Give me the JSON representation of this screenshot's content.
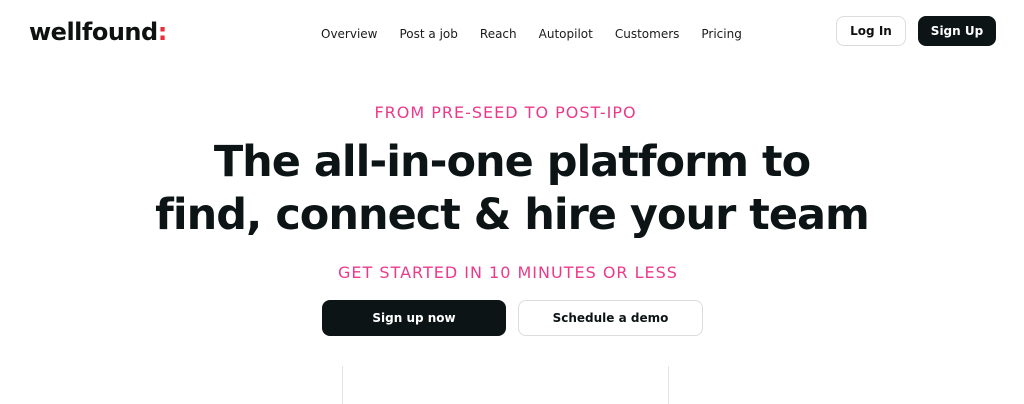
{
  "header": {
    "logo_text": "wellfound",
    "logo_colon": ":",
    "nav": [
      {
        "label": "Overview"
      },
      {
        "label": "Post a job"
      },
      {
        "label": "Reach"
      },
      {
        "label": "Autopilot"
      },
      {
        "label": "Customers"
      },
      {
        "label": "Pricing"
      }
    ],
    "login_label": "Log In",
    "signup_label": "Sign Up"
  },
  "hero": {
    "eyebrow": "FROM PRE-SEED TO POST-IPO",
    "headline_line1": "The all-in-one platform to",
    "headline_line2": "find, connect & hire your team",
    "sub_eyebrow": "GET STARTED IN 10 MINUTES OR LESS",
    "primary_cta": "Sign up now",
    "secondary_cta": "Schedule a demo"
  },
  "colors": {
    "accent_pink": "#ec3a8a",
    "logo_colon": "#ec2e3a",
    "dark": "#0d1415"
  }
}
